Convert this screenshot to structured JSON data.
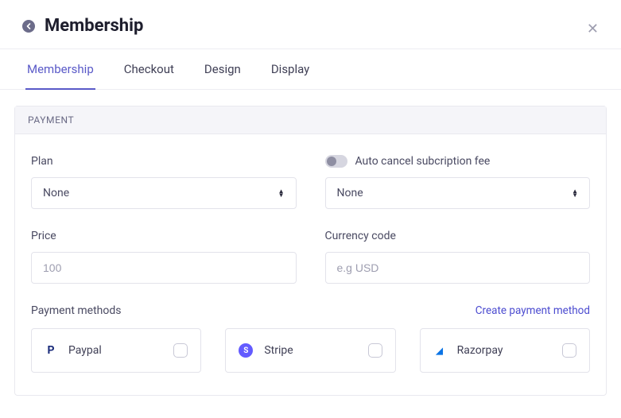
{
  "header": {
    "title": "Membership"
  },
  "tabs": [
    {
      "label": "Membership",
      "active": true
    },
    {
      "label": "Checkout",
      "active": false
    },
    {
      "label": "Design",
      "active": false
    },
    {
      "label": "Display",
      "active": false
    }
  ],
  "panel": {
    "title": "PAYMENT",
    "plan": {
      "label": "Plan",
      "value": "None"
    },
    "auto_cancel": {
      "label": "Auto cancel subcription fee",
      "enabled": false,
      "value": "None"
    },
    "price": {
      "label": "Price",
      "placeholder": "100",
      "value": ""
    },
    "currency": {
      "label": "Currency code",
      "placeholder": "e.g USD",
      "value": ""
    },
    "methods": {
      "label": "Payment methods",
      "create_link": "Create payment method",
      "items": [
        {
          "name": "Paypal",
          "icon": "paypal",
          "checked": false
        },
        {
          "name": "Stripe",
          "icon": "stripe",
          "checked": false
        },
        {
          "name": "Razorpay",
          "icon": "razorpay",
          "checked": false
        }
      ]
    }
  }
}
